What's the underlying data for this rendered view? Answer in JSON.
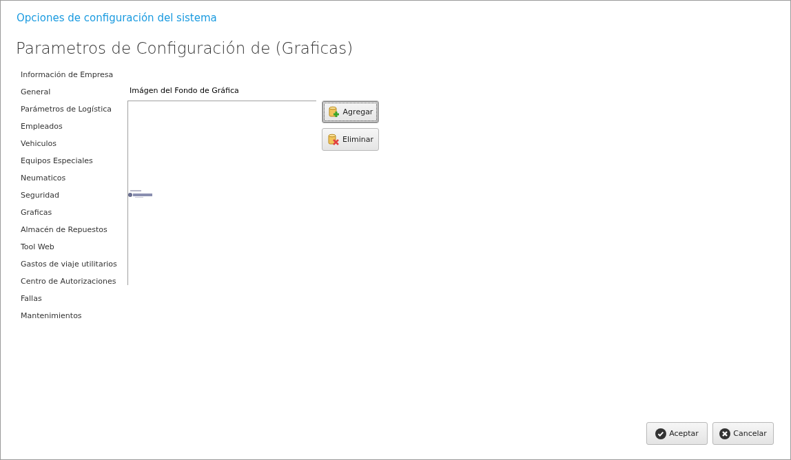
{
  "window": {
    "title": "Opciones de configuración del sistema"
  },
  "heading": "Parametros de Configuración de (Graficas)",
  "sidebar": {
    "items": [
      {
        "label": "Información de Empresa"
      },
      {
        "label": "General"
      },
      {
        "label": "Parámetros de Logística"
      },
      {
        "label": "Empleados"
      },
      {
        "label": "Vehiculos"
      },
      {
        "label": "Equipos Especiales"
      },
      {
        "label": "Neumaticos"
      },
      {
        "label": "Seguridad"
      },
      {
        "label": "Graficas"
      },
      {
        "label": "Almacén de Repuestos"
      },
      {
        "label": "Tool Web"
      },
      {
        "label": "Gastos de viaje utilitarios"
      },
      {
        "label": "Centro de Autorizaciones"
      },
      {
        "label": "Fallas"
      },
      {
        "label": "Mantenimientos"
      }
    ]
  },
  "image_section": {
    "label": "Imágen del Fondo de Gráfica",
    "buttons": [
      {
        "label": "Agregar",
        "kind": "add",
        "focused": true
      },
      {
        "label": "Eliminar",
        "kind": "remove",
        "focused": false
      }
    ]
  },
  "footer": {
    "buttons": [
      {
        "label": "Aceptar",
        "kind": "accept"
      },
      {
        "label": "Cancelar",
        "kind": "cancel"
      }
    ]
  }
}
